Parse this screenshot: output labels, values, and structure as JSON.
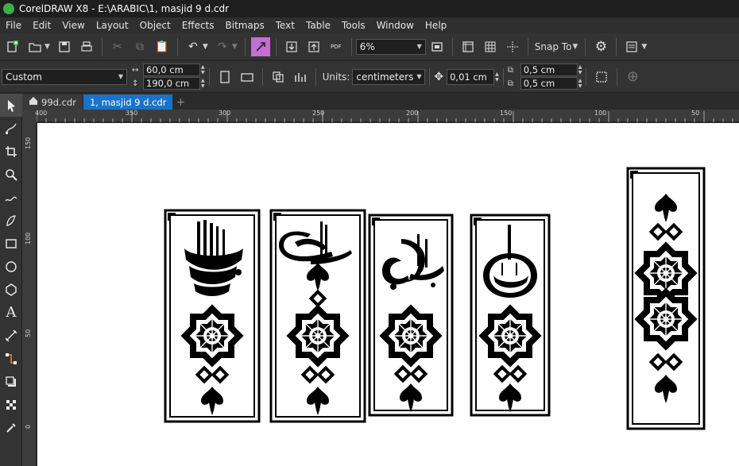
{
  "window": {
    "title": "CorelDRAW X8 - E:\\ARABIC\\1, masjid 9 d.cdr"
  },
  "menu": [
    "File",
    "Edit",
    "View",
    "Layout",
    "Object",
    "Effects",
    "Bitmaps",
    "Text",
    "Table",
    "Tools",
    "Window",
    "Help"
  ],
  "toolbar": {
    "zoom": "6%",
    "snap_to": "Snap To"
  },
  "propbar": {
    "preset": "Custom",
    "width": "60,0 cm",
    "height": "190,0 cm",
    "units_label": "Units:",
    "units": "centimeters",
    "nudge": "0,01 cm",
    "dup_x": "0,5 cm",
    "dup_y": "0,5 cm"
  },
  "tabs": [
    {
      "label": "99d.cdr",
      "active": false
    },
    {
      "label": "1, masjid 9 d.cdr",
      "active": true
    }
  ],
  "ruler_h": [
    "400",
    "350",
    "300",
    "250",
    "200",
    "150",
    "100",
    "50"
  ],
  "ruler_v": [
    "150",
    "100",
    "50",
    "0"
  ]
}
